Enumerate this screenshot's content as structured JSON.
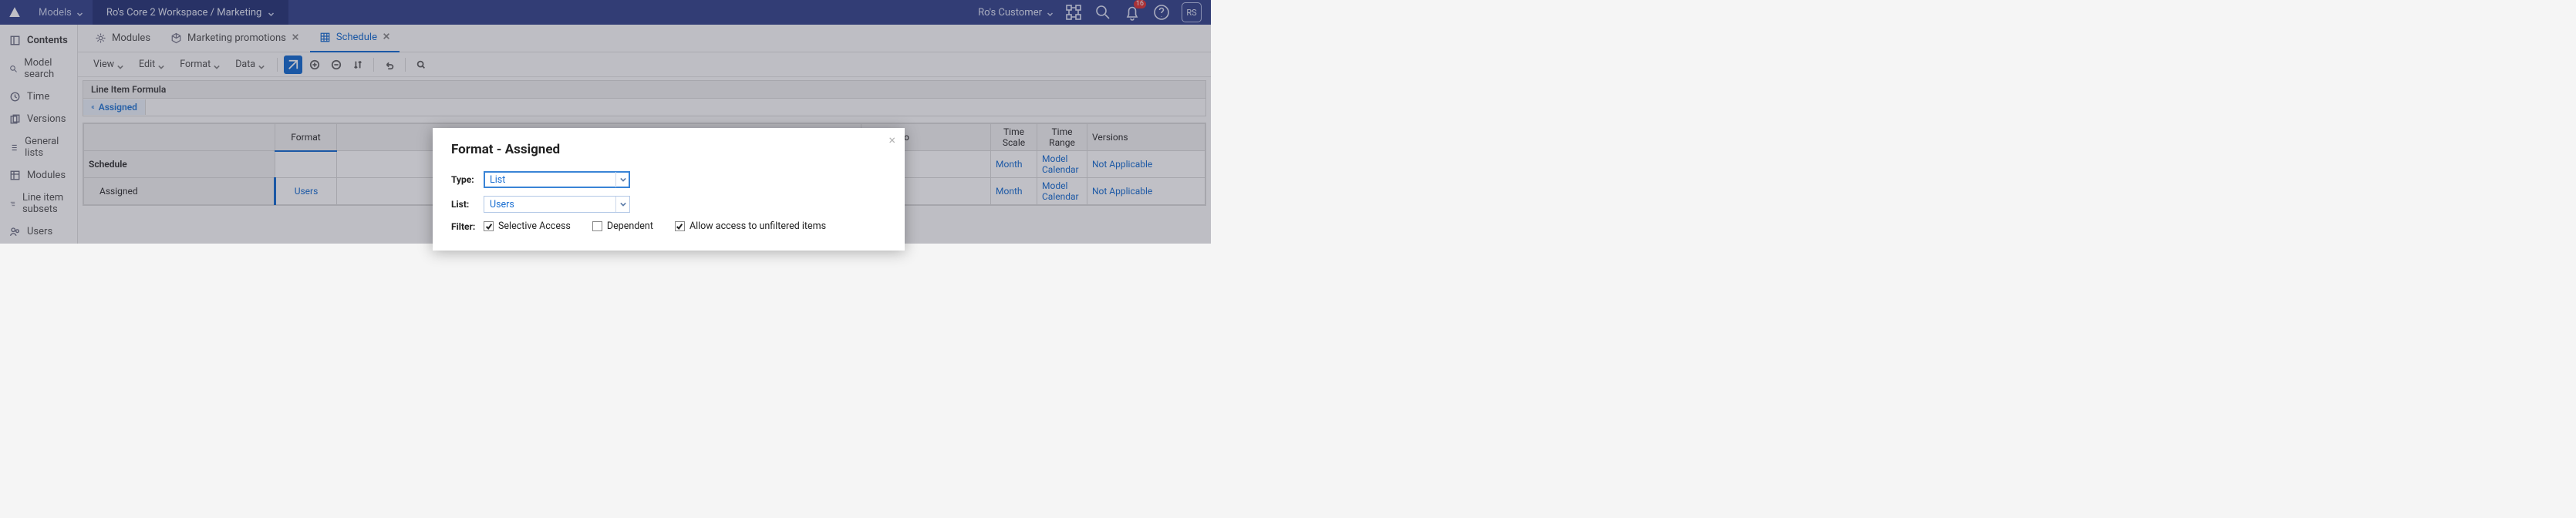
{
  "topnav": {
    "models_label": "Models",
    "workspace": "Ro's Core 2 Workspace / Marketing",
    "customer": "Ro's Customer",
    "notif_count": "16",
    "avatar": "RS"
  },
  "sidebar": {
    "contents": "Contents",
    "search": "Model search",
    "time": "Time",
    "versions": "Versions",
    "general_lists": "General lists",
    "modules": "Modules",
    "line_item_subsets": "Line item subsets",
    "users": "Users"
  },
  "tabs": {
    "modules": "Modules",
    "marketing": "Marketing promotions",
    "schedule": "Schedule"
  },
  "toolbar": {
    "view": "View",
    "edit": "Edit",
    "format": "Format",
    "data": "Data"
  },
  "formula": {
    "header": "Line Item Formula",
    "assigned": "Assigned"
  },
  "grid": {
    "headers": {
      "format": "Format",
      "applies_to": "Applies To",
      "time_scale": "Time Scale",
      "time_range": "Time Range",
      "versions": "Versions"
    },
    "rows": {
      "schedule": {
        "label": "Schedule",
        "time_scale": "Month",
        "time_range": "Model Calendar",
        "versions": "Not Applicable"
      },
      "assigned": {
        "label": "Assigned",
        "format": "Users",
        "time_scale": "Month",
        "time_range": "Model Calendar",
        "versions": "Not Applicable"
      }
    }
  },
  "dialog": {
    "title": "Format - Assigned",
    "type_label": "Type:",
    "type_value": "List",
    "list_label": "List:",
    "list_value": "Users",
    "filter_label": "Filter:",
    "selective": "Selective Access",
    "dependent": "Dependent",
    "allow_unfiltered": "Allow access to unfiltered items"
  }
}
